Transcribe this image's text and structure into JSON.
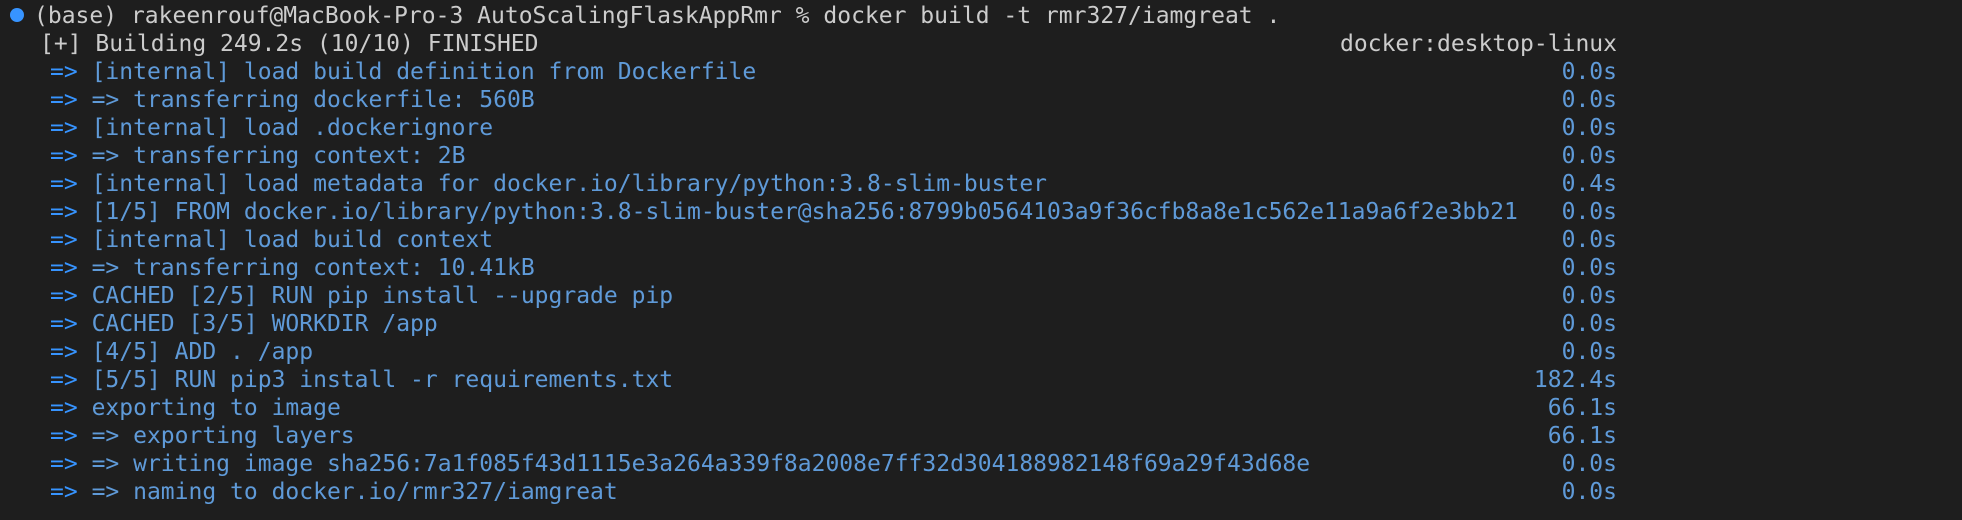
{
  "prompt": {
    "env": "(base)",
    "user_host": "rakeenrouf@MacBook-Pro-3",
    "cwd": "AutoScalingFlaskAppRmr",
    "symbol": "%",
    "command": "docker build -t rmr327/iamgreat ."
  },
  "build_header": {
    "status": "[+] Building 249.2s (10/10) FINISHED",
    "context": "docker:desktop-linux"
  },
  "steps": [
    {
      "arrow": "=>",
      "text": "[internal] load build definition from Dockerfile",
      "time": "0.0s"
    },
    {
      "arrow": "=>",
      "text": "=> transferring dockerfile: 560B",
      "time": "0.0s"
    },
    {
      "arrow": "=>",
      "text": "[internal] load .dockerignore",
      "time": "0.0s"
    },
    {
      "arrow": "=>",
      "text": "=> transferring context: 2B",
      "time": "0.0s"
    },
    {
      "arrow": "=>",
      "text": "[internal] load metadata for docker.io/library/python:3.8-slim-buster",
      "time": "0.4s"
    },
    {
      "arrow": "=>",
      "text": "[1/5] FROM docker.io/library/python:3.8-slim-buster@sha256:8799b0564103a9f36cfb8a8e1c562e11a9a6f2e3bb21",
      "time": "0.0s"
    },
    {
      "arrow": "=>",
      "text": "[internal] load build context",
      "time": "0.0s"
    },
    {
      "arrow": "=>",
      "text": "=> transferring context: 10.41kB",
      "time": "0.0s"
    },
    {
      "arrow": "=>",
      "text": "CACHED [2/5] RUN pip install --upgrade pip",
      "time": "0.0s"
    },
    {
      "arrow": "=>",
      "text": "CACHED [3/5] WORKDIR /app",
      "time": "0.0s"
    },
    {
      "arrow": "=>",
      "text": "[4/5] ADD . /app",
      "time": "0.0s"
    },
    {
      "arrow": "=>",
      "text": "[5/5] RUN pip3 install -r requirements.txt",
      "time": "182.4s"
    },
    {
      "arrow": "=>",
      "text": "exporting to image",
      "time": "66.1s"
    },
    {
      "arrow": "=>",
      "text": "=> exporting layers",
      "time": "66.1s"
    },
    {
      "arrow": "=>",
      "text": "=> writing image sha256:7a1f085f43d1115e3a264a339f8a2008e7ff32d304188982148f69a29f43d68e",
      "time": "0.0s"
    },
    {
      "arrow": "=>",
      "text": "=> naming to docker.io/rmr327/iamgreat",
      "time": "0.0s"
    }
  ]
}
